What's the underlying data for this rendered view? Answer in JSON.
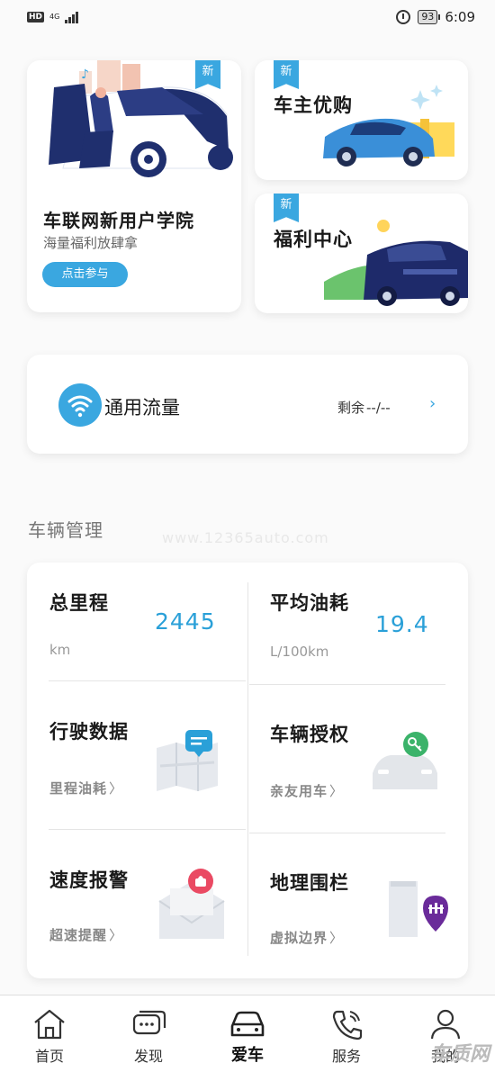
{
  "status_bar": {
    "hd": "HD",
    "network": "4G",
    "battery": "93",
    "time": "6:09"
  },
  "promo": {
    "academy": {
      "badge": "新",
      "title": "车联网新用户学院",
      "subtitle": "海量福利放肆拿",
      "button": "点击参与"
    },
    "shop": {
      "badge": "新",
      "title": "车主优购"
    },
    "welfare": {
      "badge": "新",
      "title": "福利中心"
    }
  },
  "traffic": {
    "icon": "wifi-icon",
    "label": "通用流量",
    "remain_label": "剩余",
    "remain_value": "--/--"
  },
  "section": {
    "title": "车辆管理",
    "watermark": "www.12365auto.com"
  },
  "management": {
    "mileage": {
      "title": "总里程",
      "value": "2445",
      "unit": "km"
    },
    "fuel": {
      "title": "平均油耗",
      "value": "19.4",
      "unit": "L/100km"
    },
    "driving": {
      "title": "行驶数据",
      "link": "里程油耗"
    },
    "auth": {
      "title": "车辆授权",
      "link": "亲友用车"
    },
    "speed": {
      "title": "速度报警",
      "link": "超速提醒"
    },
    "fence": {
      "title": "地理围栏",
      "link": "虚拟边界"
    }
  },
  "nav": {
    "items": [
      {
        "label": "首页",
        "icon": "home-icon"
      },
      {
        "label": "发现",
        "icon": "chat-icon"
      },
      {
        "label": "爱车",
        "icon": "car-icon",
        "active": true
      },
      {
        "label": "服务",
        "icon": "phone-icon"
      },
      {
        "label": "我的",
        "icon": "user-icon"
      }
    ],
    "corner_watermark": "车质网"
  },
  "colors": {
    "accent": "#3aa7e0",
    "value_blue": "#2aa0d8"
  }
}
